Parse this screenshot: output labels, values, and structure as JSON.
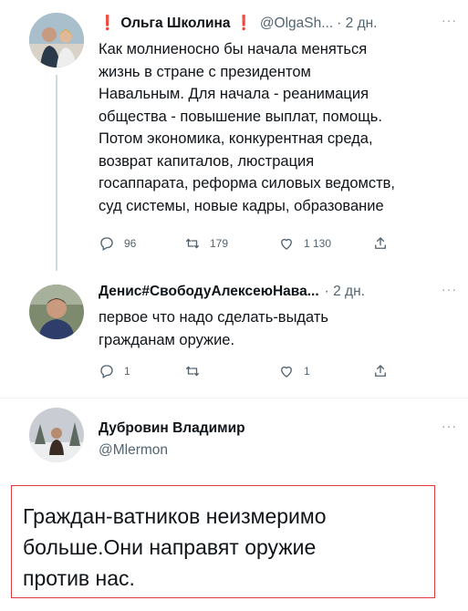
{
  "tweets": [
    {
      "name": "Ольга Школина",
      "handle": "@OlgaSh...",
      "time": "· 2 дн.",
      "more": "···",
      "lines": [
        "Как молниеносно бы начала меняться",
        "жизнь в стране с президентом",
        "Навальным. Для начала - реанимация",
        "общества - повышение выплат, помощь.",
        "Потом экономика, конкурентная среда,",
        "возврат капиталов, люстрация",
        "госаппарата, реформа силовых ведомств,",
        "суд системы, новые кадры, образование"
      ],
      "replies": "96",
      "retweets": "179",
      "likes": "1 130"
    },
    {
      "name": "Денис#СвободуАлексеюНава...",
      "time": "· 2 дн.",
      "more": "···",
      "lines": [
        "первое что надо сделать-выдать",
        "гражданам оружие."
      ],
      "replies": "1",
      "retweets": "",
      "likes": "1"
    },
    {
      "name": "Дубровин Владимир",
      "handle": "@Mlermon",
      "more": "···"
    }
  ],
  "quote": {
    "lines": [
      "Граждан-ватников неизмеримо",
      "больше.Они направят оружие",
      "против нас."
    ]
  },
  "colors": {
    "text": "#0f1419",
    "secondary": "#536471",
    "exclamation": "#e0245e",
    "highlight_border": "#e0393e"
  },
  "icons": [
    "reply-icon",
    "retweet-icon",
    "like-icon",
    "share-icon",
    "more-icon"
  ]
}
